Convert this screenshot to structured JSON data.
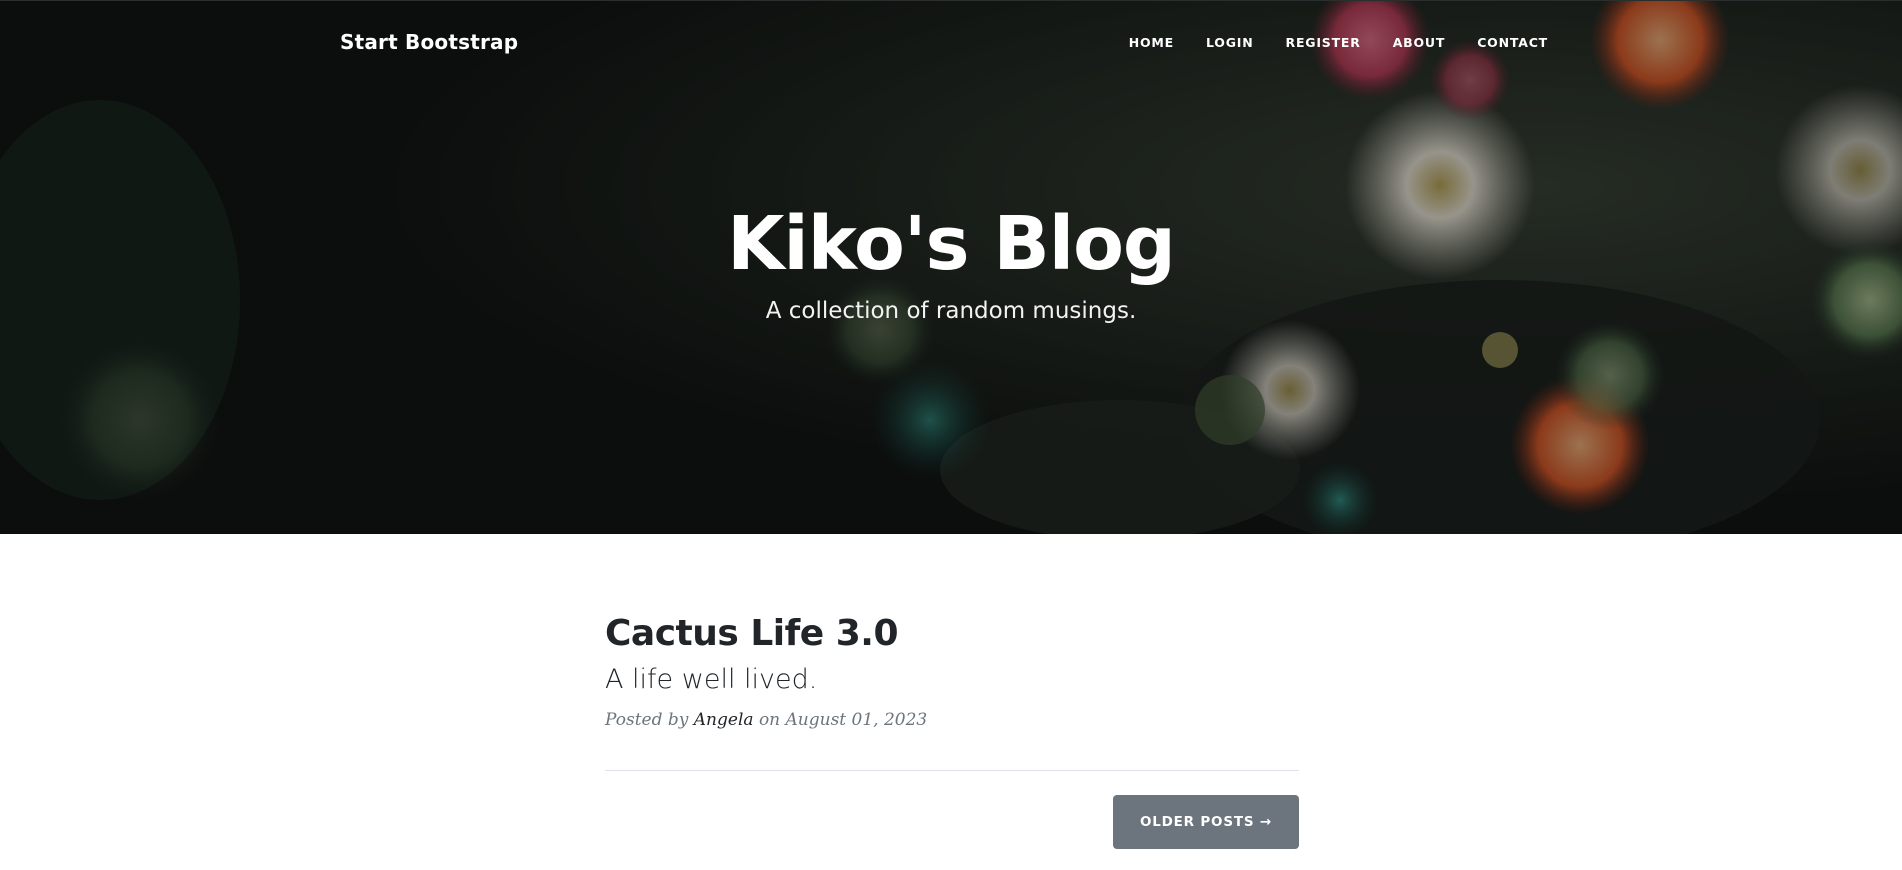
{
  "navbar": {
    "brand": "Start Bootstrap",
    "links": [
      {
        "label": "HOME"
      },
      {
        "label": "LOGIN"
      },
      {
        "label": "REGISTER"
      },
      {
        "label": "ABOUT"
      },
      {
        "label": "CONTACT"
      }
    ]
  },
  "hero": {
    "title": "Kiko's Blog",
    "subtitle": "A collection of random musings."
  },
  "posts": [
    {
      "title": "Cactus Life 3.0",
      "subtitle": "A life well lived.",
      "meta_prefix": "Posted by",
      "author": "Angela",
      "meta_on": "on",
      "date": "August 01, 2023"
    }
  ],
  "pager": {
    "older_label": "OLDER POSTS →"
  },
  "colors": {
    "button_bg": "#6c757d",
    "text_dark": "#212529",
    "meta_grey": "#6c757d",
    "hero_overlay": "#121614"
  }
}
